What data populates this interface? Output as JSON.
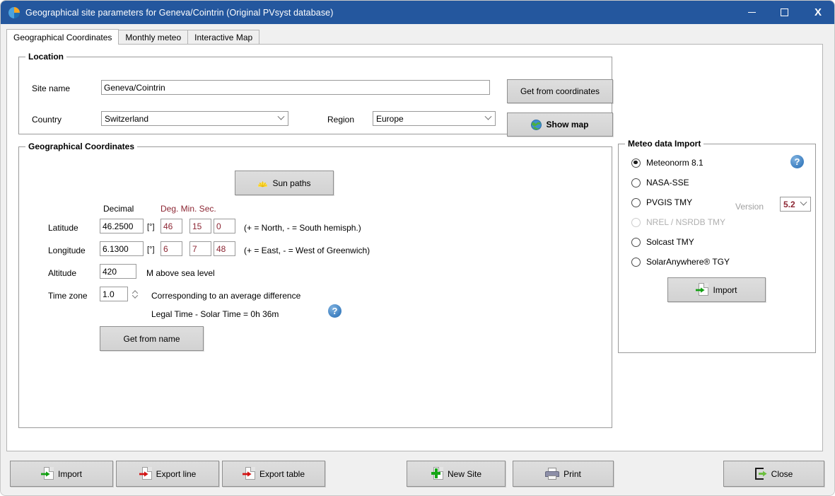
{
  "window": {
    "title": "Geographical site parameters for Geneva/Cointrin (Original PVsyst database)",
    "icon": "pvsyst-logo-icon",
    "minimize_label": "–",
    "maximize_label": "□",
    "close_label": "X",
    "titlebar_color": "#24579e"
  },
  "tabs": [
    {
      "label": "Geographical Coordinates",
      "active": true
    },
    {
      "label": "Monthly meteo",
      "active": false
    },
    {
      "label": "Interactive Map",
      "active": false
    }
  ],
  "location": {
    "group_title": "Location",
    "site_name_label": "Site name",
    "site_name_value": "Geneva/Cointrin",
    "country_label": "Country",
    "country_value": "Switzerland",
    "region_label": "Region",
    "region_value": "Europe",
    "get_from_coordinates_label": "Get from coordinates",
    "show_map_label": "Show map"
  },
  "geo": {
    "group_title": "Geographical Coordinates",
    "sun_paths_label": "Sun paths",
    "header_decimal": "Decimal",
    "header_dms": "Deg. Min. Sec.",
    "dms_color": "#8c2633",
    "latitude_label": "Latitude",
    "latitude_decimal": "46.2500",
    "latitude_deg": "46",
    "latitude_min": "15",
    "latitude_sec": "0",
    "latitude_hint": "(+ = North, - = South hemisph.)",
    "longitude_label": "Longitude",
    "longitude_decimal": "6.1300",
    "longitude_deg": "6",
    "longitude_min": "7",
    "longitude_sec": "48",
    "longitude_hint": "(+ = East, - = West of Greenwich)",
    "degree_unit": "[°]",
    "altitude_label": "Altitude",
    "altitude_value": "420",
    "altitude_unit": "M above sea level",
    "timezone_label": "Time zone",
    "timezone_value": "1.0",
    "timezone_hint": "Corresponding to an average difference",
    "legal_time_line": "Legal Time - Solar Time =   0h 36m",
    "get_from_name_label": "Get from name",
    "help_label": "?"
  },
  "meteo": {
    "group_title": "Meteo data Import",
    "help_label": "?",
    "version_label": "Version",
    "version_value": "5.2",
    "import_label": "Import",
    "options": [
      {
        "label": "Meteonorm 8.1",
        "selected": true,
        "disabled": false
      },
      {
        "label": "NASA-SSE",
        "selected": false,
        "disabled": false
      },
      {
        "label": "PVGIS TMY",
        "selected": false,
        "disabled": false
      },
      {
        "label": "NREL / NSRDB TMY",
        "selected": false,
        "disabled": true
      },
      {
        "label": "Solcast TMY",
        "selected": false,
        "disabled": false
      },
      {
        "label": "SolarAnywhere® TGY",
        "selected": false,
        "disabled": false
      }
    ]
  },
  "footer": {
    "import_label": "Import",
    "export_line_label": "Export line",
    "export_table_label": "Export table",
    "new_site_label": "New Site",
    "print_label": "Print",
    "close_label": "Close"
  }
}
